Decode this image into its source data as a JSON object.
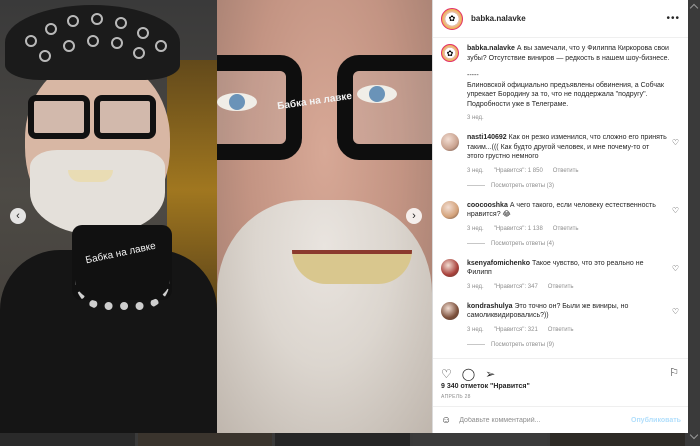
{
  "photo": {
    "left_overlay_text": "Бабка на лавке",
    "right_overlay_text": "Бабка на лавке"
  },
  "post": {
    "username": "babka.nalavke",
    "more_icon": "more-horizontal-icon",
    "caption_user": "babka.nalavke",
    "caption_text": "А вы замечали, что у Филиппа Киркорова свои зубы? Отсутствие виниров — редкость в нашем шоу-бизнесе.",
    "caption_sep": "-----",
    "caption_text2": "Блиновской официально предъявлены обвинения, а Собчак упрекает Бородину за то, что не поддержала \"подругу\". Подробности уже в Телеграме.",
    "caption_time": "3 нед."
  },
  "comments": [
    {
      "user": "nasti140692",
      "text": "Как он резко изменился, что сложно его принять таким...((( Как будто другой человек, и мне почему-то от этого грустно немного",
      "time": "3 нед.",
      "likes": "\"Нравится\": 1 850",
      "reply": "Ответить",
      "view_replies": "Посмотреть ответы (3)",
      "avatar_color": "#c9a28f"
    },
    {
      "user": "coocooshka",
      "text": "А чего такого, если человеку естественность нравится? 😂",
      "time": "3 нед.",
      "likes": "\"Нравится\": 1 138",
      "reply": "Ответить",
      "view_replies": "Посмотреть ответы (4)",
      "avatar_color": "#d3a27a"
    },
    {
      "user": "ksenyafomichenko",
      "text": "Такое чувство, что это реально не Филипп",
      "time": "3 нед.",
      "likes": "\"Нравится\": 347",
      "reply": "Ответить",
      "view_replies": "",
      "avatar_color": "#a8403a"
    },
    {
      "user": "kondrashulya",
      "text": "Это точно он? Были же виниры, но самоликвидировались?))",
      "time": "3 нед.",
      "likes": "\"Нравится\": 321",
      "reply": "Ответить",
      "view_replies": "Посмотреть ответы (9)",
      "avatar_color": "#7b4f3a"
    }
  ],
  "actions": {
    "like_icon": "heart-icon",
    "comment_icon": "comment-icon",
    "share_icon": "send-icon",
    "save_icon": "bookmark-icon"
  },
  "likes_text": "9 340 отметок \"Нравится\"",
  "date_text": "АПРЕЛЬ 28",
  "comment_input": {
    "placeholder": "Добавьте комментарий...",
    "publish_label": "Опубликовать"
  }
}
